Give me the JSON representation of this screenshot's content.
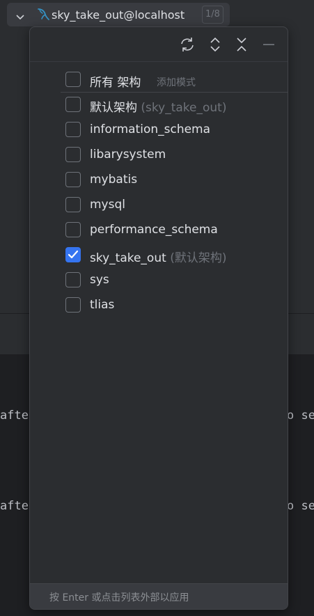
{
  "selector": {
    "connection_label": "sky_take_out@localhost",
    "count_badge": "1/8",
    "icons": {
      "expand": "chevron-down-icon",
      "datasource": "mysql-dolphin-icon"
    }
  },
  "toolbar": {
    "buttons": [
      "refresh-icon",
      "expand-all-icon",
      "collapse-all-icon",
      "minimize-icon"
    ]
  },
  "schemas": {
    "all": {
      "label": "所有 架构",
      "hint": "添加模式",
      "checked": false
    },
    "items": [
      {
        "label": "默认架构",
        "hint": "(sky_take_out)",
        "checked": false
      },
      {
        "label": "information_schema",
        "hint": "",
        "checked": false
      },
      {
        "label": "libarysystem",
        "hint": "",
        "checked": false
      },
      {
        "label": "mybatis",
        "hint": "",
        "checked": false
      },
      {
        "label": "mysql",
        "hint": "",
        "checked": false
      },
      {
        "label": "performance_schema",
        "hint": "",
        "checked": false
      },
      {
        "label": "sky_take_out",
        "hint": "(默认架构)",
        "checked": true
      },
      {
        "label": "sys",
        "hint": "",
        "checked": false
      },
      {
        "label": "tlias",
        "hint": "",
        "checked": false
      }
    ]
  },
  "footer": {
    "hint": "按 Enter 或点击列表外部以应用"
  },
  "editor": {
    "lines": [
      {
        "left": "afte",
        "right": "o se"
      },
      {
        "left": "afte",
        "right": "o se"
      }
    ]
  },
  "colors": {
    "accent": "#3574f0",
    "background": "#2b2d30",
    "editor_background": "#1e1f22",
    "text": "#dfe1e5",
    "muted_text": "#6f737a"
  }
}
